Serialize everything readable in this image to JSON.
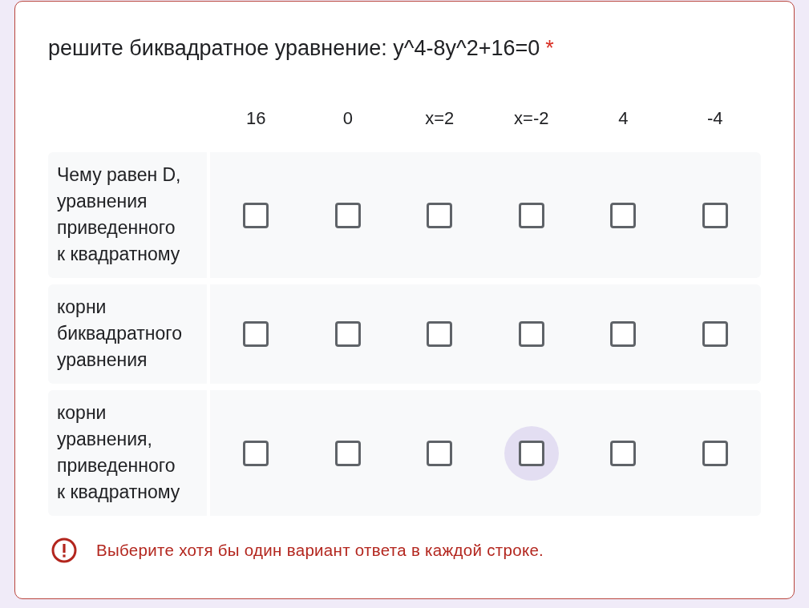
{
  "question": {
    "title": "решите биквадратное уравнение: y^4-8y^2+16=0",
    "required_mark": "*"
  },
  "grid": {
    "columns": [
      "16",
      "0",
      "x=2",
      "x=-2",
      "4",
      "-4"
    ],
    "rows": [
      {
        "label": "Чему равен D, уравнения приведенного к квадратному",
        "cells": [
          {
            "checked": false,
            "focused": false
          },
          {
            "checked": false,
            "focused": false
          },
          {
            "checked": false,
            "focused": false
          },
          {
            "checked": false,
            "focused": false
          },
          {
            "checked": false,
            "focused": false
          },
          {
            "checked": false,
            "focused": false
          }
        ]
      },
      {
        "label": "корни биквадратного уравнения",
        "cells": [
          {
            "checked": false,
            "focused": false
          },
          {
            "checked": false,
            "focused": false
          },
          {
            "checked": false,
            "focused": false
          },
          {
            "checked": false,
            "focused": false
          },
          {
            "checked": false,
            "focused": false
          },
          {
            "checked": false,
            "focused": false
          }
        ]
      },
      {
        "label": "корни уравнения, приведенного к квадратному",
        "cells": [
          {
            "checked": false,
            "focused": false
          },
          {
            "checked": false,
            "focused": false
          },
          {
            "checked": false,
            "focused": false
          },
          {
            "checked": false,
            "focused": true
          },
          {
            "checked": false,
            "focused": false
          },
          {
            "checked": false,
            "focused": false
          }
        ]
      }
    ]
  },
  "error": {
    "message": "Выберите хотя бы один вариант ответа в каждой строке."
  }
}
